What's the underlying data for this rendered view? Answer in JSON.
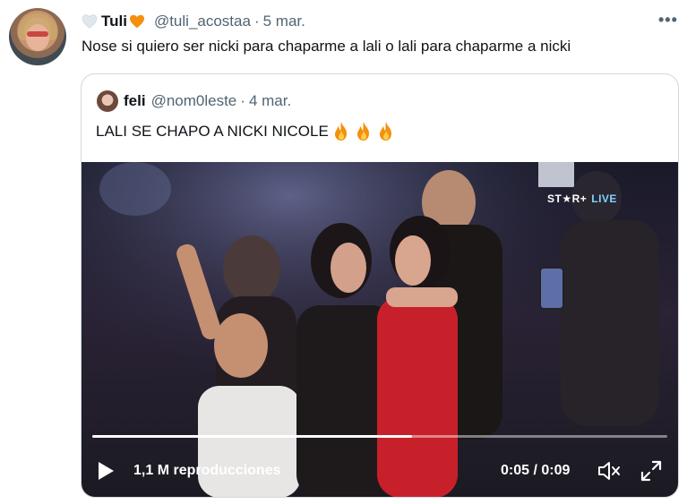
{
  "tweet": {
    "display_name": "Tuli",
    "handle": "@tuli_acostaa",
    "separator": "·",
    "date": "5 mar.",
    "text": "Nose si quiero ser nicki para chaparme a lali o lali para chaparme a nicki",
    "more_icon": "more-horizontal-icon",
    "name_icons": [
      "white-heart-icon",
      "orange-heart-icon"
    ]
  },
  "quoted": {
    "display_name": "feli",
    "handle": "@nom0leste",
    "separator": "·",
    "date": "4 mar.",
    "text": "LALI SE CHAPO A NICKI NICOLE",
    "emoji_icons": [
      "fire-icon",
      "fire-icon",
      "fire-icon"
    ]
  },
  "video": {
    "brand": "ST★R+",
    "live_label": "LIVE",
    "views": "1,1 M reproducciones",
    "time": "0:05 / 0:09",
    "progress_fraction": 0.556,
    "icons": [
      "play-icon",
      "volume-muted-icon",
      "fullscreen-icon"
    ]
  },
  "colors": {
    "text_primary": "#0f1419",
    "text_secondary": "#536471",
    "border": "#cfd9de",
    "heart_orange": "#f4900c",
    "heart_white": "#e1e8ed",
    "live_blue": "#7fd3ff"
  }
}
